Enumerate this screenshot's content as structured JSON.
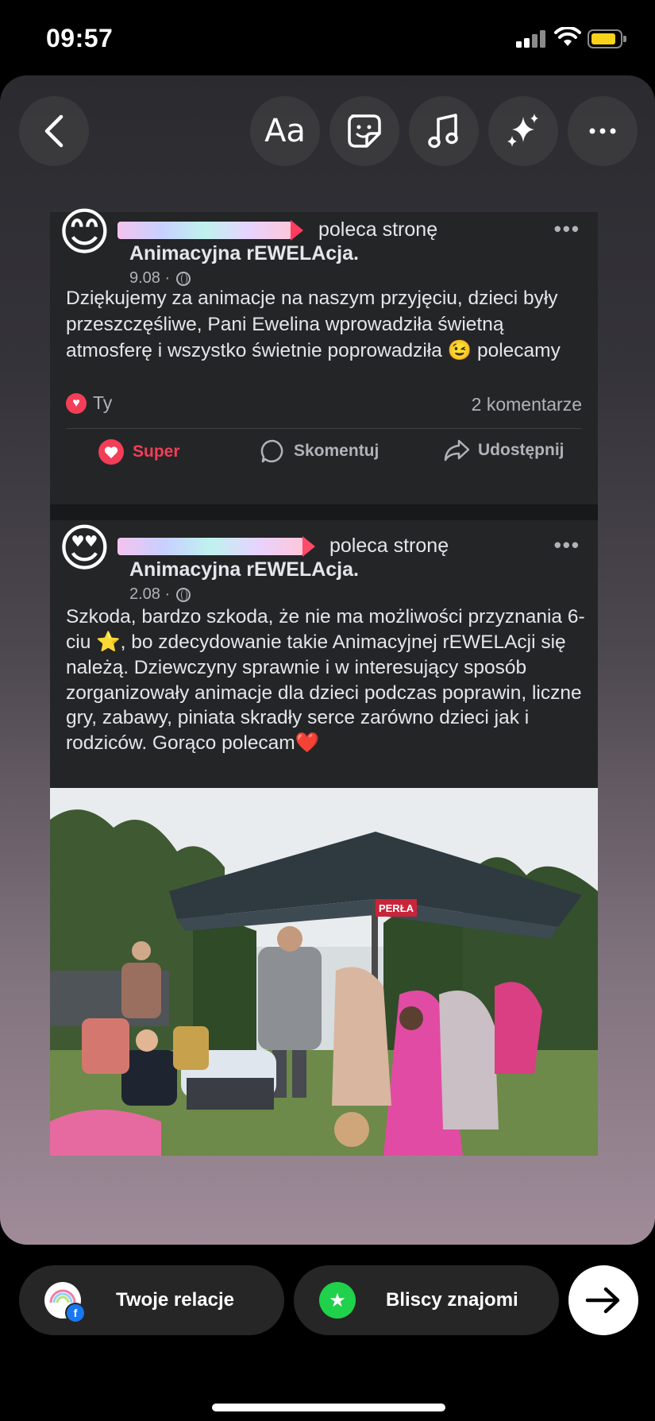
{
  "status": {
    "time": "09:57"
  },
  "toolbar": {
    "text_label": "Aa",
    "icons": [
      "back-chevron-icon",
      "text-tool",
      "sticker-icon",
      "music-icon",
      "effects-sparkle-icon",
      "more-icon"
    ]
  },
  "posts": [
    {
      "emoji": "😊",
      "verb": "poleca stronę",
      "page_name": "Animacyjna rEWELAcja.",
      "date": "9.08 ·",
      "body": "Dziękujemy za animacje na naszym przyjęciu, dzieci były przeszczęśliwe, Pani Ewelina wprowadziła świetną atmosferę i wszystko świetnie poprowadziła 😉 polecamy",
      "reaction_by": "Ty",
      "comments": "2 komentarze",
      "actions": {
        "super": "Super",
        "comment": "Skomentuj",
        "share": "Udostępnij"
      }
    },
    {
      "emoji": "😍",
      "verb": "poleca stronę",
      "page_name": "Animacyjna rEWELAcja.",
      "date": "2.08 ·",
      "body": "Szkoda, bardzo szkoda, że nie ma możliwości przyznania 6-ciu ⭐, bo zdecydowanie takie Animacyjnej rEWELAcji się należą. Dziewczyny sprawnie i w interesujący sposób zorganizowały animacje dla dzieci podczas poprawin, liczne gry, zabawy, piniata skradły serce zarówno dzieci jak i rodziców. Gorąco polecam❤️"
    }
  ],
  "photo": {
    "umbrella_brand": "PERŁA"
  },
  "bottom": {
    "your_story": "Twoje relacje",
    "close_friends": "Bliscy znajomi",
    "colors": {
      "accent_green": "#1fd14b",
      "fb_blue": "#1877f2"
    }
  }
}
